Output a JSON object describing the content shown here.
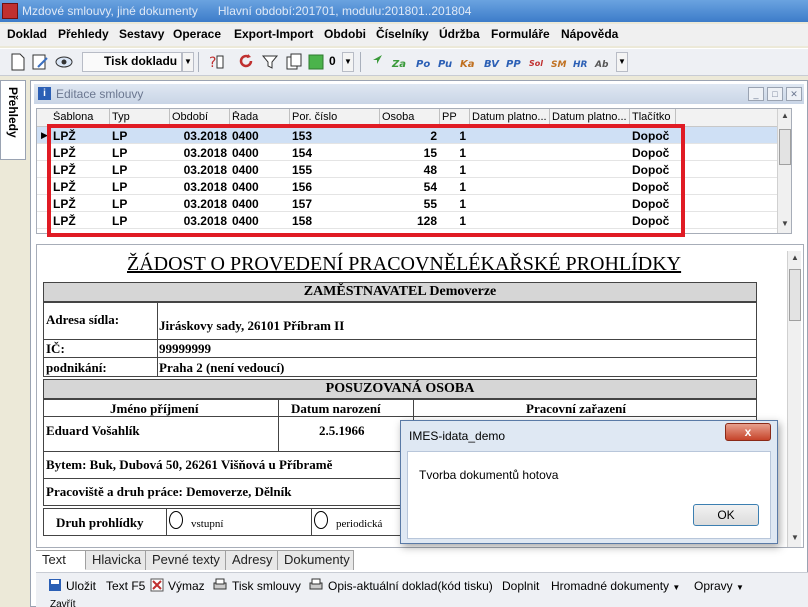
{
  "window": {
    "title": "Mzdové smlouvy, jiné dokumenty",
    "period_info": "Hlavní období:201701, modulu:201801..201804"
  },
  "menu": [
    "Doklad",
    "Přehledy",
    "Sestavy",
    "Operace",
    "Export-Import",
    "Obdobi",
    "Číselníky",
    "Údržba",
    "Formuláře",
    "Nápověda"
  ],
  "toolbar": {
    "print_label": "Tisk dokladu",
    "counter": "0"
  },
  "side_tab": "Přehledy",
  "subwindow": {
    "title": "Editace smlouvy"
  },
  "grid": {
    "columns": [
      "Šablona",
      "Typ",
      "Období",
      "Řada",
      "Por. číslo",
      "Osoba",
      "PP",
      "Datum platno...",
      "Datum platno...",
      "Tlačítko"
    ],
    "rows": [
      [
        "LPŽ",
        "LP",
        "03.2018",
        "0400",
        "153",
        "2",
        "1",
        "",
        "",
        "Dopoč"
      ],
      [
        "LPŽ",
        "LP",
        "03.2018",
        "0400",
        "154",
        "15",
        "1",
        "",
        "",
        "Dopoč"
      ],
      [
        "LPŽ",
        "LP",
        "03.2018",
        "0400",
        "155",
        "48",
        "1",
        "",
        "",
        "Dopoč"
      ],
      [
        "LPŽ",
        "LP",
        "03.2018",
        "0400",
        "156",
        "54",
        "1",
        "",
        "",
        "Dopoč"
      ],
      [
        "LPŽ",
        "LP",
        "03.2018",
        "0400",
        "157",
        "55",
        "1",
        "",
        "",
        "Dopoč"
      ],
      [
        "LPŽ",
        "LP",
        "03.2018",
        "0400",
        "158",
        "128",
        "1",
        "",
        "",
        "Dopoč"
      ]
    ]
  },
  "document": {
    "heading": "ŽÁDOST O PROVEDENÍ PRACOVNĚLÉKAŘSKÉ PROHLÍDKY",
    "employer_section": "ZAMĚSTNAVATEL",
    "employer_name": "Demoverze",
    "address_label": "Adresa sídla:",
    "address_value": "Jiráskovy sady, 26101 Příbram II",
    "ic_label": "IČ:",
    "ic_value": "99999999",
    "business_label": "podnikání:",
    "business_value": "Praha 2 (není vedoucí)",
    "person_section": "POSUZOVANÁ OSOBA",
    "name_label": "Jméno příjmení",
    "birth_label": "Datum narození",
    "position_label": "Pracovní zařazení",
    "name_value": "Eduard Vošahlík",
    "birth_value": "2.5.1966",
    "residence": "Bytem: Buk, Dubová 50, 26261 Višňová u Příbramě",
    "workplace": "Pracoviště a druh práce: Demoverze, Dělník",
    "exam_type_label": "Druh prohlídky",
    "option_entry": "vstupní",
    "option_periodic": "periodická"
  },
  "tabs": [
    "Text",
    "Hlavicka",
    "Pevné texty",
    "Adresy",
    "Dokumenty"
  ],
  "bottom": {
    "save": "Uložit",
    "text_f5": "Text F5",
    "cut": "Výmaz",
    "print_contract": "Tisk smlouvy",
    "copy_print": "Opis-aktuální doklad(kód tisku)",
    "add": "Doplnit",
    "bulk_docs": "Hromadné dokumenty",
    "fixes": "Opravy",
    "close": "Zavřít"
  },
  "dialog": {
    "title": "IMES-idata_demo",
    "message": "Tvorba dokumentů hotova",
    "ok": "OK",
    "close": "x"
  },
  "colors": {
    "highlight_box": "#e01b24",
    "selected_row": "#cfe0f5"
  }
}
